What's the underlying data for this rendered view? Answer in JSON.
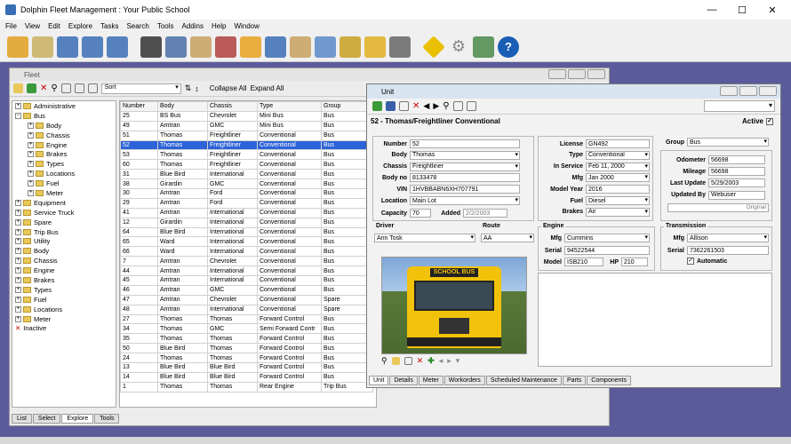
{
  "app": {
    "title": "Dolphin Fleet Management : Your Public School"
  },
  "menu": [
    "File",
    "View",
    "Edit",
    "Explore",
    "Tasks",
    "Search",
    "Tools",
    "Addins",
    "Help",
    "Window"
  ],
  "toolbar_icons": [
    "bus-icon",
    "wrench-icon",
    "form-icon",
    "calendar-icon",
    "chart-icon",
    "fuel-pump-icon",
    "clipboard-icon",
    "card-icon",
    "people-icon",
    "parts-icon",
    "inventory-icon",
    "report-icon",
    "invoice-icon",
    "bottles-icon",
    "forklift-icon",
    "tire-icon",
    "warning-icon",
    "gear-icon",
    "graph-icon",
    "help-icon"
  ],
  "fleet": {
    "title": "Fleet",
    "sort_value": "Sort",
    "collapse_all": "Collapse All",
    "expand_all": "Expand All",
    "tree": [
      {
        "label": "Administrative",
        "lvl": 0,
        "exp": "+"
      },
      {
        "label": "Bus",
        "lvl": 0,
        "exp": "−"
      },
      {
        "label": "Body",
        "lvl": 1,
        "exp": "+"
      },
      {
        "label": "Chassis",
        "lvl": 1,
        "exp": "+"
      },
      {
        "label": "Engine",
        "lvl": 1,
        "exp": "+"
      },
      {
        "label": "Brakes",
        "lvl": 1,
        "exp": "+"
      },
      {
        "label": "Types",
        "lvl": 1,
        "exp": "+"
      },
      {
        "label": "Locations",
        "lvl": 1,
        "exp": "+"
      },
      {
        "label": "Fuel",
        "lvl": 1,
        "exp": "+"
      },
      {
        "label": "Meter",
        "lvl": 1,
        "exp": "+"
      },
      {
        "label": "Equipment",
        "lvl": 0,
        "exp": "+"
      },
      {
        "label": "Service Truck",
        "lvl": 0,
        "exp": "+"
      },
      {
        "label": "Spare",
        "lvl": 0,
        "exp": "+"
      },
      {
        "label": "Trip Bus",
        "lvl": 0,
        "exp": "+"
      },
      {
        "label": "Utility",
        "lvl": 0,
        "exp": "+"
      },
      {
        "label": "Body",
        "lvl": 0,
        "exp": "+"
      },
      {
        "label": "Chassis",
        "lvl": 0,
        "exp": "+"
      },
      {
        "label": "Engine",
        "lvl": 0,
        "exp": "+"
      },
      {
        "label": "Brakes",
        "lvl": 0,
        "exp": "+"
      },
      {
        "label": "Types",
        "lvl": 0,
        "exp": "+"
      },
      {
        "label": "Fuel",
        "lvl": 0,
        "exp": "+"
      },
      {
        "label": "Locations",
        "lvl": 0,
        "exp": "+"
      },
      {
        "label": "Meter",
        "lvl": 0,
        "exp": "+"
      },
      {
        "label": "Inactive",
        "lvl": 0,
        "exp": ""
      }
    ],
    "columns": [
      "Number",
      "Body",
      "Chassis",
      "Type",
      "Group"
    ],
    "rows": [
      [
        "25",
        "BS Bus",
        "Chevrolet",
        "Mini Bus",
        "Bus"
      ],
      [
        "49",
        "Amtran",
        "GMC",
        "Mini Bus",
        "Bus"
      ],
      [
        "51",
        "Thomas",
        "Freightliner",
        "Conventional",
        "Bus"
      ],
      [
        "52",
        "Thomas",
        "Freightliner",
        "Conventional",
        "Bus"
      ],
      [
        "53",
        "Thomas",
        "Freightliner",
        "Conventional",
        "Bus"
      ],
      [
        "60",
        "Thomas",
        "Freightliner",
        "Conventional",
        "Bus"
      ],
      [
        "31",
        "Blue Bird",
        "International",
        "Conventional",
        "Bus"
      ],
      [
        "38",
        "Girardin",
        "GMC",
        "Conventional",
        "Bus"
      ],
      [
        "30",
        "Amtran",
        "Ford",
        "Conventional",
        "Bus"
      ],
      [
        "29",
        "Amtran",
        "Ford",
        "Conventional",
        "Bus"
      ],
      [
        "41",
        "Amtran",
        "International",
        "Conventional",
        "Bus"
      ],
      [
        "12",
        "Girardin",
        "International",
        "Conventional",
        "Bus"
      ],
      [
        "64",
        "Blue Bird",
        "International",
        "Conventional",
        "Bus"
      ],
      [
        "65",
        "Ward",
        "International",
        "Conventional",
        "Bus"
      ],
      [
        "66",
        "Ward",
        "International",
        "Conventional",
        "Bus"
      ],
      [
        "7",
        "Amtran",
        "Chevrolet",
        "Conventional",
        "Bus"
      ],
      [
        "44",
        "Amtran",
        "International",
        "Conventional",
        "Bus"
      ],
      [
        "45",
        "Amtran",
        "International",
        "Conventional",
        "Bus"
      ],
      [
        "46",
        "Amtran",
        "GMC",
        "Conventional",
        "Bus"
      ],
      [
        "47",
        "Amtran",
        "Chevrolet",
        "Conventional",
        "Spare"
      ],
      [
        "48",
        "Amtran",
        "International",
        "Conventional",
        "Spare"
      ],
      [
        "27",
        "Thomas",
        "Thomas",
        "Forward Control",
        "Bus"
      ],
      [
        "34",
        "Thomas",
        "GMC",
        "Semi Forward Contr",
        "Bus"
      ],
      [
        "35",
        "Thomas",
        "Thomas",
        "Forward Control",
        "Bus"
      ],
      [
        "50",
        "Blue Bird",
        "Thomas",
        "Forward Control",
        "Bus"
      ],
      [
        "24",
        "Thomas",
        "Thomas",
        "Forward Control",
        "Bus"
      ],
      [
        "13",
        "Blue Bird",
        "Blue Bird",
        "Forward Control",
        "Bus"
      ],
      [
        "14",
        "Blue Bird",
        "Blue Bird",
        "Forward Control",
        "Bus"
      ],
      [
        "1",
        "Thomas",
        "Thomas",
        "Rear Engine",
        "Trip Bus"
      ]
    ],
    "selected_row": 3,
    "tabs": [
      "List",
      "Select",
      "Explore",
      "Tools"
    ],
    "active_tab": 2
  },
  "unit": {
    "title": "Unit",
    "heading": "52 - Thomas/Freightliner Conventional",
    "active_label": "Active",
    "left_fields": [
      {
        "label": "Number",
        "value": "52",
        "dd": false
      },
      {
        "label": "Body",
        "value": "Thomas",
        "dd": true
      },
      {
        "label": "Chassis",
        "value": "Freightliner",
        "dd": true
      },
      {
        "label": "Body no",
        "value": "8133478",
        "dd": false
      },
      {
        "label": "VIN",
        "value": "1HVBBABN6XH707791",
        "dd": false
      },
      {
        "label": "Location",
        "value": "Main Lot",
        "dd": true
      }
    ],
    "capacity_label": "Capacity",
    "capacity": "70",
    "added_label": "Added",
    "added": "2/2/2003",
    "mid_fields": [
      {
        "label": "License",
        "value": "GN492",
        "dd": false
      },
      {
        "label": "Type",
        "value": "Conventional",
        "dd": true
      },
      {
        "label": "In Service",
        "value": "Feb 11, 2000",
        "dd": true
      },
      {
        "label": "Mfg",
        "value": "Jan 2000",
        "dd": true
      },
      {
        "label": "Model Year",
        "value": "2016",
        "dd": false
      },
      {
        "label": "Fuel",
        "value": "Diesel",
        "dd": true
      },
      {
        "label": "Brakes",
        "value": "Air",
        "dd": true
      }
    ],
    "group_label": "Group",
    "group_value": "Bus",
    "right_fields": [
      {
        "label": "Odometer",
        "value": "56698"
      },
      {
        "label": "Mileage",
        "value": "56698"
      },
      {
        "label": "Last Update",
        "value": "5/29/2003"
      },
      {
        "label": "Updated By",
        "value": "Webuser"
      }
    ],
    "original_note": "Original",
    "driver_label": "Driver",
    "driver": "Ann Tosk",
    "route_label": "Route",
    "route": "AA",
    "engine_label": "Engine",
    "eng_mfg_label": "Mfg",
    "eng_mfg": "Cummins",
    "eng_serial_label": "Serial",
    "eng_serial": "94522544",
    "eng_model_label": "Model",
    "eng_model": "ISB210",
    "eng_hp_label": "HP",
    "eng_hp": "210",
    "trans_label": "Transmission",
    "trans_mfg_label": "Mfg",
    "trans_mfg": "Allison",
    "trans_serial_label": "Serial",
    "trans_serial": "7362261503",
    "automatic_label": "Automatic",
    "bus_sign": "SCHOOL BUS",
    "tabs": [
      "Unit",
      "Details",
      "Meter",
      "Workorders",
      "Scheduled Maintenance",
      "Parts",
      "Components"
    ],
    "active_tab": 0
  }
}
